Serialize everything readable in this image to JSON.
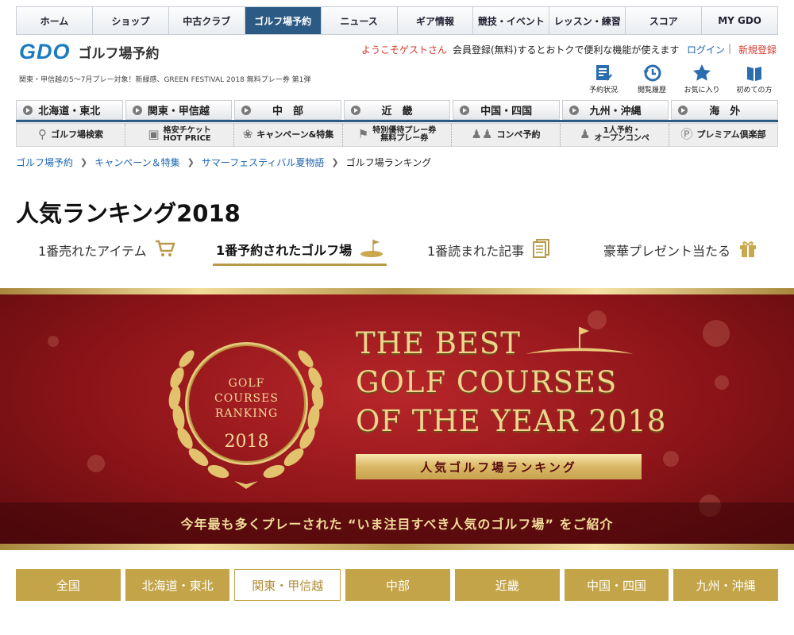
{
  "top_nav": [
    "ホーム",
    "ショップ",
    "中古クラブ",
    "ゴルフ場予約",
    "ニュース",
    "ギア情報",
    "競技・イベント",
    "レッスン・練習",
    "スコア",
    "MY GDO"
  ],
  "header": {
    "logo": "GDO",
    "title": "ゴルフ場予約",
    "tagline": "関東・甲信越の5〜7月プレー対象！新緑感、GREEN FESTIVAL 2018 無料プレー券 第1弾",
    "welcome": "ようこそゲストさん",
    "promo": "会員登録(無料)するとおトクで便利な機能が使えます",
    "login": "ログイン",
    "separator": "|",
    "register": "新規登録"
  },
  "utils": [
    {
      "label": "予約状況",
      "icon": "reservation-list-icon"
    },
    {
      "label": "閲覧履歴",
      "icon": "history-clock-icon"
    },
    {
      "label": "お気に入り",
      "icon": "star-icon"
    },
    {
      "label": "初めての方",
      "icon": "book-icon"
    }
  ],
  "regions": [
    "北海道・東北",
    "関東・甲信越",
    "中　部",
    "近　畿",
    "中国・四国",
    "九州・沖縄",
    "海　外"
  ],
  "services": [
    {
      "line1": "ゴルフ場検索",
      "line2": "",
      "icon": "search-icon"
    },
    {
      "line1": "格安チケット",
      "line2": "HOT PRICE",
      "icon": "ticket-icon"
    },
    {
      "line1": "キャンペーン&特集",
      "line2": "",
      "icon": "ribbon-icon"
    },
    {
      "line1": "特別優待プレー券",
      "line2": "無料プレー券",
      "icon": "flag-icon"
    },
    {
      "line1": "コンペ予約",
      "line2": "",
      "icon": "group-icon"
    },
    {
      "line1": "1人予約・",
      "line2": "オープンコンペ",
      "icon": "person-icon"
    },
    {
      "line1": "プレミアム倶楽部",
      "line2": "",
      "icon": "premium-icon"
    }
  ],
  "breadcrumb": [
    "ゴルフ場予約",
    "キャンペーン＆特集",
    "サマーフェスティバル夏物語",
    "ゴルフ場ランキング"
  ],
  "page_title": "人気ランキング2018",
  "tabs": [
    {
      "label": "1番売れたアイテム",
      "icon": "cart-icon"
    },
    {
      "label": "1番予約されたゴルフ場",
      "icon": "golf-flag-icon"
    },
    {
      "label": "1番読まれた記事",
      "icon": "document-icon"
    },
    {
      "label": "豪華プレゼント当たる",
      "icon": "gift-icon"
    }
  ],
  "banner": {
    "medal_line1": "GOLF",
    "medal_line2": "COURSES",
    "medal_line3": "RANKING",
    "medal_year": "2018",
    "title_line1": "THE BEST",
    "title_line2": "GOLF COURSES",
    "title_line3": "OF THE YEAR 2018",
    "subtitle": "人気ゴルフ場ランキング",
    "caption": "今年最も多くプレーされた “いま注目すべき人気のゴルフ場” をご紹介"
  },
  "region_tabs": [
    "全国",
    "北海道・東北",
    "関東・甲信越",
    "中部",
    "近畿",
    "中国・四国",
    "九州・沖縄"
  ],
  "colors": {
    "nav_active": "#2b5a84",
    "gold": "#c4a448",
    "banner_red": "#8c1418",
    "link": "#1a63b0",
    "accent_red": "#d43a2c"
  }
}
